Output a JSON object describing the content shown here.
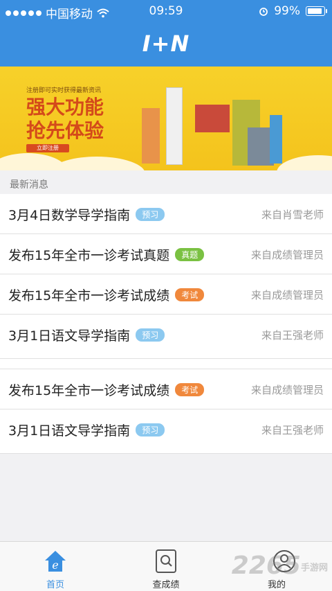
{
  "status_bar": {
    "carrier": "中国移动",
    "time": "09:59",
    "battery": "99%"
  },
  "header": {
    "logo": "I+N"
  },
  "banner": {
    "subtitle": "注册即可实时获得最新资讯",
    "headline_line1": "强大功能",
    "headline_line2": "抢先体验",
    "cta": "立即注册"
  },
  "section_title": "最新消息",
  "news": [
    {
      "title": "3月4日数学导学指南",
      "tag": "预习",
      "tag_color": "#8cc9f0",
      "source": "来自肖雪老师"
    },
    {
      "title": "发布15年全市一诊考试真题",
      "tag": "真题",
      "tag_color": "#7ac142",
      "source": "来自成绩管理员"
    },
    {
      "title": "发布15年全市一诊考试成绩",
      "tag": "考试",
      "tag_color": "#f0883c",
      "source": "来自成绩管理员"
    },
    {
      "title": "3月1日语文导学指南",
      "tag": "预习",
      "tag_color": "#8cc9f0",
      "source": "来自王强老师"
    },
    {
      "title": "发布15年全市一诊考试成绩",
      "tag": "考试",
      "tag_color": "#f0883c",
      "source": "来自成绩管理员"
    },
    {
      "title": "3月1日语文导学指南",
      "tag": "预习",
      "tag_color": "#8cc9f0",
      "source": "来自王强老师"
    }
  ],
  "tabbar": {
    "home": {
      "label": "首页",
      "icon": "home-icon"
    },
    "grades": {
      "label": "查成绩",
      "icon": "search-icon"
    },
    "mine": {
      "label": "我的",
      "icon": "user-icon"
    }
  },
  "watermark": {
    "number": "2265",
    "text": "手游网"
  },
  "colors": {
    "primary": "#3a8fe0",
    "banner": "#f4c31c"
  }
}
